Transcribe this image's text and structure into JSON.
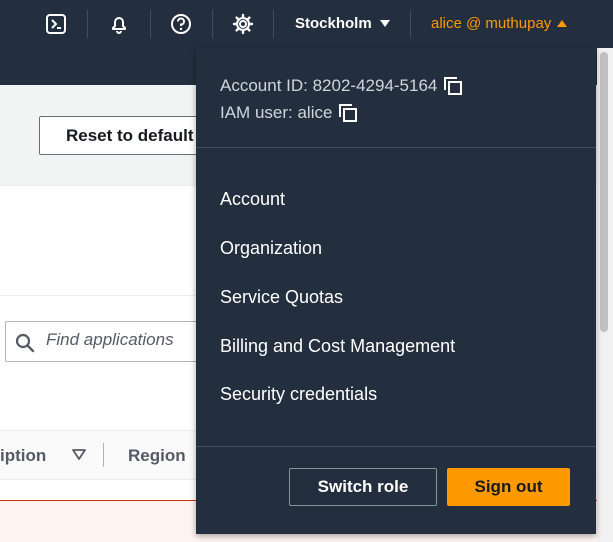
{
  "topnav": {
    "icons": [
      "cloudshell-icon",
      "notifications-bell-icon",
      "help-icon",
      "settings-gear-icon"
    ],
    "region_label": "Stockholm",
    "account_label": "alice @ muthupay",
    "accent_color": "#ff9900",
    "background_color": "#232f3e"
  },
  "page": {
    "reset_button_label": "Reset to default",
    "search_placeholder": "Find applications",
    "table_headers": [
      "iption",
      "Region"
    ]
  },
  "account_menu": {
    "account_id_text": "Account ID: 8202-4294-5164",
    "iam_user_text": "IAM user: alice",
    "items": [
      {
        "label": "Account"
      },
      {
        "label": "Organization"
      },
      {
        "label": "Service Quotas"
      },
      {
        "label": "Billing and Cost Management"
      },
      {
        "label": "Security credentials"
      }
    ],
    "switch_role_label": "Switch role",
    "sign_out_label": "Sign out"
  }
}
